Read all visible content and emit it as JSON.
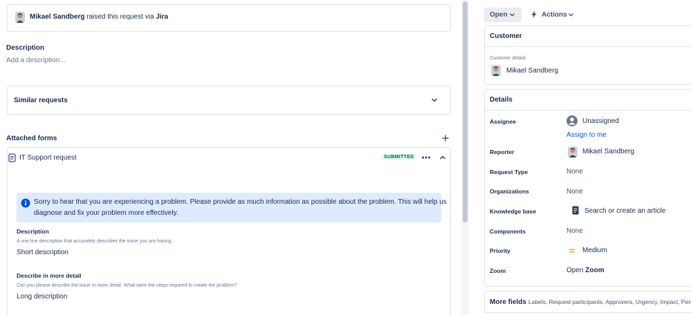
{
  "activity": {
    "reporter_name": "Mikael Sandberg",
    "raised_text": "raised this request via",
    "channel": "Jira"
  },
  "description": {
    "heading": "Description",
    "placeholder": "Add a description..."
  },
  "similar": {
    "label": "Similar requests"
  },
  "forms": {
    "heading": "Attached forms",
    "form_title": "IT Support request",
    "status": "SUBMITTED",
    "info_text_1": "Sorry to hear that you are experiencing a problem. Please provide as much information as possible about the problem. This will help us",
    "info_text_2": "diagnose and fix your problem more effectively.",
    "fields": [
      {
        "label": "Description",
        "help": "A one line description that accurately describes the issue you are having",
        "value": "Short description"
      },
      {
        "label": "Describe in more detail",
        "help": "Can you please describe the issue in more detail. What were the steps required to create the problem?",
        "value": "Long description"
      }
    ]
  },
  "toolbar": {
    "status_label": "Open",
    "actions_label": "Actions"
  },
  "customer": {
    "heading": "Customer",
    "sub_label": "Customer details",
    "name": "Mikael Sandberg"
  },
  "details": {
    "heading": "Details",
    "assignee_label": "Assignee",
    "assignee_value": "Unassigned",
    "assign_link": "Assign to me",
    "reporter_label": "Reporter",
    "reporter_value": "Mikael Sandberg",
    "request_type_label": "Request Type",
    "request_type_value": "None",
    "organizations_label": "Organizations",
    "organizations_value": "None",
    "knowledge_label": "Knowledge base",
    "knowledge_value": "Search or create an article",
    "components_label": "Components",
    "components_value": "None",
    "priority_label": "Priority",
    "priority_value": "Medium",
    "zoom_label": "Zoom",
    "zoom_open": "Open",
    "zoom_value": "Zoom"
  },
  "more_fields": {
    "label": "More fields",
    "list": "Labels, Request participants, Approvers, Urgency, Impact, Pending reason"
  },
  "colors": {
    "link": "#0052cc",
    "status_badge_bg": "#e3fcef",
    "status_badge_text": "#006644",
    "info_bg": "#deebff",
    "info_icon": "#0052cc",
    "priority": "#ff991f"
  }
}
